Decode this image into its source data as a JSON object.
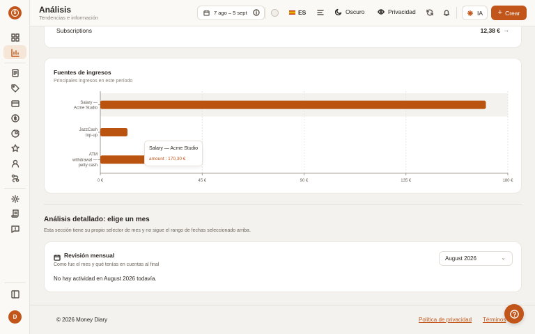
{
  "app": {
    "avatar_initial": "D",
    "logo_glyph": "$"
  },
  "header": {
    "title": "Análisis",
    "subtitle": "Tendencias e información",
    "date_range": "7 ago – 5 sept",
    "language": "ES",
    "theme_label": "Oscuro",
    "privacy_label": "Privacidad",
    "ai_label": "IA",
    "create_label": "Crear",
    "create_plus": "+"
  },
  "subscriptions": {
    "label": "Subscriptions",
    "value": "12,38 €",
    "arrow": "→"
  },
  "income_sources": {
    "title": "Fuentes de ingresos",
    "subtitle": "Principales ingresos en este período",
    "tooltip": {
      "title": "Salary — Acme Studio",
      "value": "amount : 170,30 €"
    }
  },
  "chart_data": {
    "type": "bar",
    "orientation": "horizontal",
    "categories": [
      [
        "Salary —",
        "Acme Studio"
      ],
      [
        "JazzCash",
        "top-up"
      ],
      [
        "ATM",
        "withdrawal —",
        "petty cash"
      ]
    ],
    "series": [
      {
        "values": [
          170.3,
          12.0,
          23.5
        ]
      }
    ],
    "xlim": [
      0,
      180
    ],
    "xticks": [
      0,
      45,
      90,
      135,
      180
    ],
    "xtick_labels": [
      "0 €",
      "45 €",
      "90 €",
      "135 €",
      "180 €"
    ],
    "grid": true,
    "color": "#b9530f",
    "highlight_category_index": 0
  },
  "detailed": {
    "title": "Análisis detallado: elige un mes",
    "subtitle": "Esta sección tiene su propio selector de mes y no sigue el rango de fechas seleccionado arriba."
  },
  "monthly_review": {
    "title": "Revisión mensual",
    "subtitle": "Como fue el mes y qué tenías en cuentas al final",
    "empty_text": "No hay actividad en August 2026 todavía.",
    "selected_month": "August 2026"
  },
  "footer": {
    "copyright": "© 2026 Money Diary",
    "privacy_link": "Política de privacidad",
    "terms_link": "Términos"
  }
}
